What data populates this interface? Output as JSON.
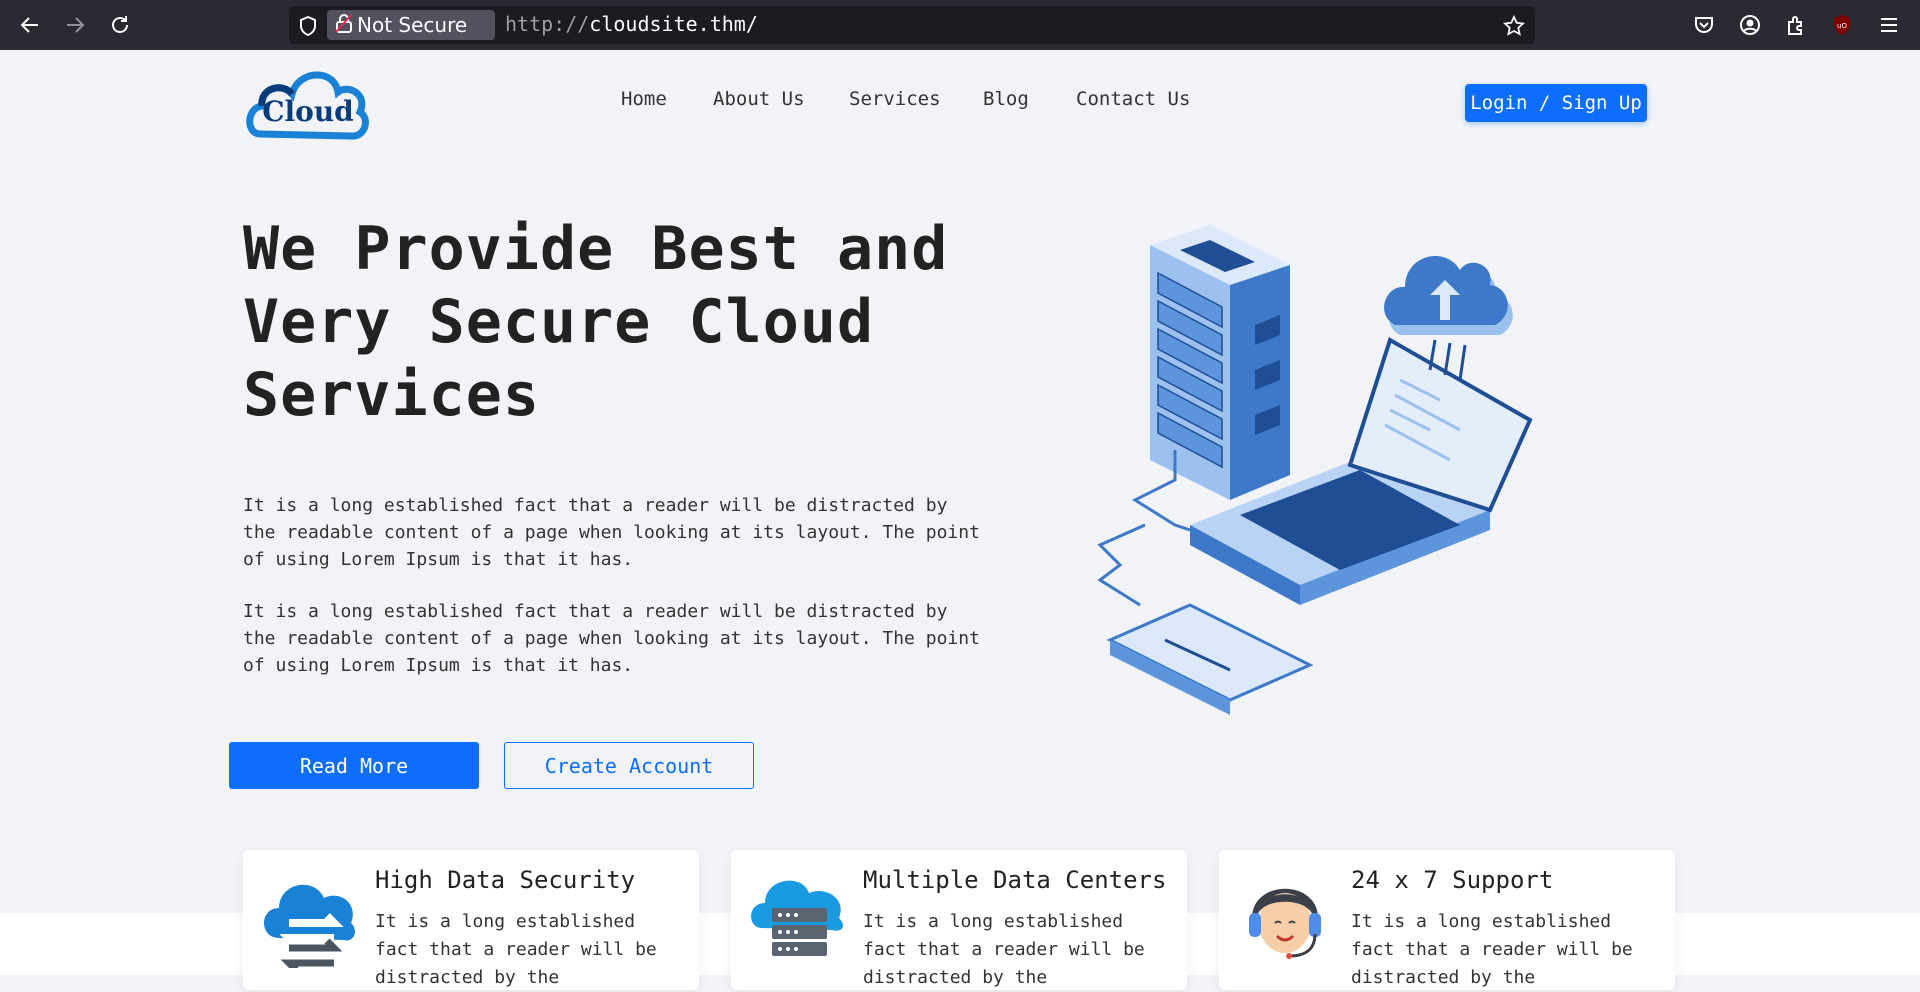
{
  "browser": {
    "security_label": "Not Secure",
    "url_protocol": "http://",
    "url_host": "cloudsite.thm/",
    "icons": [
      "back-arrow-icon",
      "forward-arrow-icon",
      "reload-icon",
      "shield-icon",
      "lock-icon",
      "star-icon",
      "pocket-icon",
      "account-icon",
      "extensions-icon",
      "ublock-icon",
      "menu-icon"
    ]
  },
  "site": {
    "logo_text": "Cloud",
    "nav": [
      "Home",
      "About Us",
      "Services",
      "Blog",
      "Contact Us"
    ],
    "login_label": "Login / Sign Up"
  },
  "hero": {
    "title": "We Provide Best and Very Secure Cloud Services",
    "paragraphs": [
      "It is a long established fact that a reader will be distracted by the readable content of a page when looking at its layout. The point of using Lorem Ipsum is that it has.",
      "It is a long established fact that a reader will be distracted by the readable content of a page when looking at its layout. The point of using Lorem Ipsum is that it has."
    ],
    "read_more_label": "Read More",
    "create_account_label": "Create Account"
  },
  "features": [
    {
      "title": "High Data Security",
      "text": "It is a long established fact that a reader will be distracted by the",
      "icon": "cloud-transfer-icon"
    },
    {
      "title": "Multiple Data Centers",
      "text": "It is a long established fact that a reader will be distracted by the",
      "icon": "cloud-server-icon"
    },
    {
      "title": "24 x 7 Support",
      "text": "It is a long established fact that a reader will be distracted by the",
      "icon": "support-agent-icon"
    }
  ],
  "colors": {
    "accent": "#0d6efd",
    "page_bg": "#f1f3f7",
    "chrome_bg": "#2b2a33"
  }
}
